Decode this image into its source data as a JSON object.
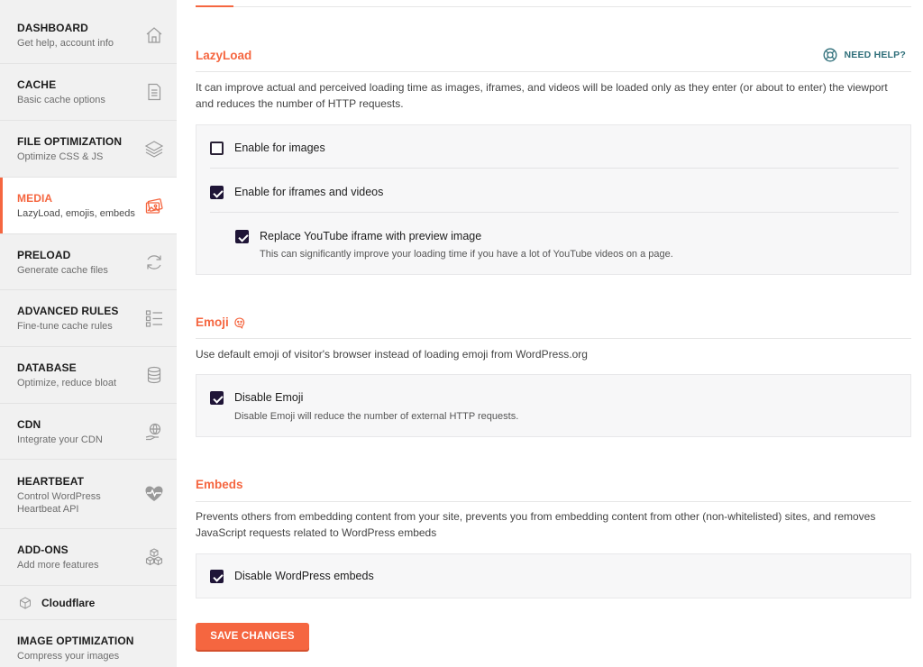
{
  "sidebar": {
    "items": [
      {
        "title": "DASHBOARD",
        "subtitle": "Get help, account info",
        "icon": "home-icon"
      },
      {
        "title": "CACHE",
        "subtitle": "Basic cache options",
        "icon": "document-icon"
      },
      {
        "title": "FILE OPTIMIZATION",
        "subtitle": "Optimize CSS & JS",
        "icon": "layers-icon"
      },
      {
        "title": "MEDIA",
        "subtitle": "LazyLoad, emojis, embeds",
        "icon": "images-icon"
      },
      {
        "title": "PRELOAD",
        "subtitle": "Generate cache files",
        "icon": "refresh-icon"
      },
      {
        "title": "ADVANCED RULES",
        "subtitle": "Fine-tune cache rules",
        "icon": "list-icon"
      },
      {
        "title": "DATABASE",
        "subtitle": "Optimize, reduce bloat",
        "icon": "database-icon"
      },
      {
        "title": "CDN",
        "subtitle": "Integrate your CDN",
        "icon": "globe-hand-icon"
      },
      {
        "title": "HEARTBEAT",
        "subtitle": "Control WordPress Heartbeat API",
        "icon": "heartbeat-icon"
      },
      {
        "title": "ADD-ONS",
        "subtitle": "Add more features",
        "icon": "cubes-icon"
      }
    ],
    "cloudflare": {
      "label": "Cloudflare",
      "icon": "cube-icon"
    },
    "image_optimization": {
      "title": "IMAGE OPTIMIZATION",
      "subtitle": "Compress your images"
    }
  },
  "need_help": {
    "label": "NEED HELP?",
    "icon": "lifebuoy-icon"
  },
  "lazyload": {
    "title": "LazyLoad",
    "description": "It can improve actual and perceived loading time as images, iframes, and videos will be loaded only as they enter (or about to enter) the viewport and reduces the number of HTTP requests.",
    "images": {
      "label": "Enable for images",
      "checked": false
    },
    "iframes": {
      "label": "Enable for iframes and videos",
      "checked": true
    },
    "youtube": {
      "label": "Replace YouTube iframe with preview image",
      "help": "This can significantly improve your loading time if you have a lot of YouTube videos on a page.",
      "checked": true
    }
  },
  "emoji": {
    "title": "Emoji",
    "description": "Use default emoji of visitor's browser instead of loading emoji from WordPress.org",
    "disable": {
      "label": "Disable Emoji",
      "help": "Disable Emoji will reduce the number of external HTTP requests.",
      "checked": true
    }
  },
  "embeds": {
    "title": "Embeds",
    "description": "Prevents others from embedding content from your site, prevents you from embedding content from other (non-whitelisted) sites, and removes JavaScript requests related to WordPress embeds",
    "disable": {
      "label": "Disable WordPress embeds",
      "checked": true
    }
  },
  "save_label": "SAVE CHANGES",
  "colors": {
    "accent": "#f56640",
    "checkbox": "#1f1537",
    "help_link": "#2f6f7a"
  }
}
